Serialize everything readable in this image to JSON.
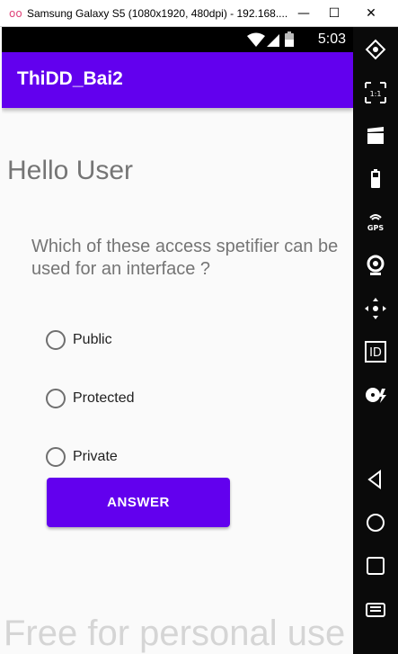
{
  "window": {
    "title": "Samsung Galaxy S5 (1080x1920, 480dpi) - 192.168....",
    "logo_icon": "genymotion-logo-icon",
    "minimize_label": "—",
    "maximize_label": "☐",
    "close_label": "✕"
  },
  "statusbar": {
    "time": "5:03",
    "icons": [
      "wifi-icon",
      "signal-icon",
      "battery-icon"
    ]
  },
  "appbar": {
    "title": "ThiDD_Bai2",
    "color": "#6200ee"
  },
  "content": {
    "greeting": "Hello User",
    "question": "Which of these access spetifier can be used for an interface ?",
    "options": [
      {
        "label": "Public",
        "selected": false
      },
      {
        "label": "Protected",
        "selected": false
      },
      {
        "label": "Private",
        "selected": false
      }
    ],
    "answer_button": "ANSWER"
  },
  "emulator_panel": {
    "buttons": [
      {
        "icon": "rotate-icon"
      },
      {
        "icon": "pixel-perfect-icon",
        "text": "1:1"
      },
      {
        "icon": "screencast-icon"
      },
      {
        "icon": "battery-icon"
      },
      {
        "icon": "gps-icon",
        "text": "GPS"
      },
      {
        "icon": "camera-icon"
      },
      {
        "icon": "dpad-icon"
      },
      {
        "icon": "identifiers-icon",
        "text": "ID"
      },
      {
        "icon": "disk-io-icon"
      },
      {
        "icon": "back-icon"
      },
      {
        "icon": "home-icon"
      },
      {
        "icon": "recent-apps-icon"
      },
      {
        "icon": "menu-icon"
      }
    ]
  },
  "watermark": "Free for personal use"
}
